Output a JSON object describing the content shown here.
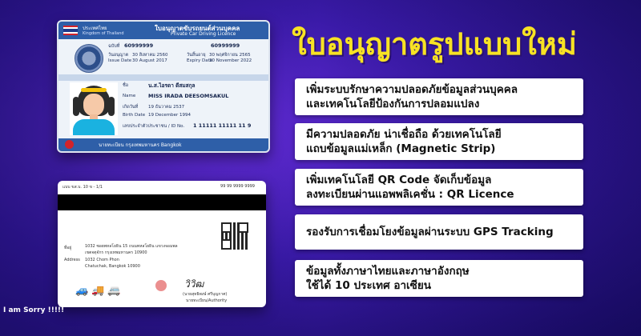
{
  "front_card": {
    "org_th": "ประเทศไทย",
    "org_en": "Kingdom of Thailand",
    "title_th": "ใบอนุญาตขับรถยนต์ส่วนบุคคล",
    "title_en": "Private Car Driving Licence",
    "license_no_label": "ฉบับที่",
    "license_no": "60999999",
    "license_no_2": "60999999",
    "issue_label": "วันอนุญาต",
    "issue_th": "30 สิงหาคม 2560",
    "issue_en_label": "Issue Date",
    "issue_en": "30 August 2017",
    "expiry_label": "วันสิ้นอายุ",
    "expiry_th": "30 พฤศจิกายน 2565",
    "expiry_en_label": "Expiry Date",
    "expiry_en": "30 November 2022",
    "name_label": "ชื่อ",
    "name_th": "น.ส.ไอรดา ดีสมสกุล",
    "name_en_label": "Name",
    "name_en": "MISS IRADA  DEESOMSAKUL",
    "dob_label": "เกิดวันที่",
    "dob_th": "19 ธันวาคม 2537",
    "dob_en_label": "Birth Date",
    "dob_en": "19 December 1994",
    "id_label": "เลขประจำตัวประชาชน / ID No.",
    "id_no": "1 11111 11111 11 9",
    "footer": "นายทะเบียน กรุงเทพมหานคร Bangkok"
  },
  "back_card": {
    "top_text": "แบบ ขส.บ. 10 ข - 1/1",
    "barcode_no": "99 99 9999 9999",
    "address_label_th": "ที่อยู่",
    "address_th": "1032 ซอยพหลโยธิน 15 ถนนพหลโยธิน แขวงจอมพล",
    "address_th_2": "เขตจตุจักร กรุงเทพมหานคร 10900",
    "address_label_en": "Address",
    "address_en": "1032 Chom Phon",
    "address_en_2": "Chatuchak, Bangkok 10900",
    "vehicles": "🚙🚚🚐",
    "signature": "วิวิฒ",
    "signer": "(นายสุทธิพงษ์ ศรีบุญกาศ)",
    "signer_title": "นายทะเบียน/Authority"
  },
  "watermark": "I am Sorry !!!!!",
  "title": "ใบอนุญาตรูปแบบใหม่",
  "features": [
    {
      "lines": [
        "เพิ่มระบบรักษาความปลอดภัยข้อมูลส่วนบุคคล",
        "และเทคโนโลยีป้องกันการปลอมแปลง"
      ]
    },
    {
      "lines": [
        "มีความปลอดภัย น่าเชื่อถือ ด้วยเทคโนโลยี",
        "แถบข้อมูลแม่เหล็ก (Magnetic Strip)"
      ]
    },
    {
      "lines": [
        "เพิ่มเทคโนโลยี QR Code จัดเก็บข้อมูล",
        "ลงทะเบียนผ่านแอพพลิเคชั่น : QR Licence"
      ]
    },
    {
      "lines": [
        "รองรับการเชื่อมโยงข้อมูลผ่านระบบ GPS Tracking"
      ]
    },
    {
      "lines": [
        "ข้อมูลทั้งภาษาไทยและภาษาอังกฤษ",
        "ใช้ได้ 10 ประเทศ อาเซียน"
      ]
    }
  ],
  "colors": {
    "title": "#f7e224",
    "card_blue": "#2e5fa8",
    "background": "#3a1aa8"
  }
}
